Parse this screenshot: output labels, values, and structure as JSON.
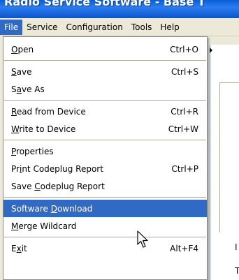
{
  "window": {
    "title": "Radio Service Software - Base T"
  },
  "menubar": {
    "items": [
      {
        "label": "File",
        "active": true
      },
      {
        "label": "Service",
        "active": false
      },
      {
        "label": "Configuration",
        "active": false
      },
      {
        "label": "Tools",
        "active": false
      },
      {
        "label": "Help",
        "active": false
      }
    ]
  },
  "file_menu": {
    "open": {
      "before": "",
      "mnemonic": "O",
      "after": "pen",
      "shortcut": "Ctrl+O"
    },
    "save": {
      "before": "",
      "mnemonic": "S",
      "after": "ave",
      "shortcut": "Ctrl+S"
    },
    "save_as": {
      "before": "S",
      "mnemonic": "a",
      "after": "ve As",
      "shortcut": ""
    },
    "read_from_device": {
      "before": "",
      "mnemonic": "R",
      "after": "ead from Device",
      "shortcut": "Ctrl+R"
    },
    "write_to_device": {
      "before": "",
      "mnemonic": "W",
      "after": "rite to Device",
      "shortcut": "Ctrl+W"
    },
    "properties": {
      "before": "",
      "mnemonic": "P",
      "after": "roperties",
      "shortcut": ""
    },
    "print_codeplug_report": {
      "before": "Pr",
      "mnemonic": "i",
      "after": "nt Codeplug Report",
      "shortcut": "Ctrl+P"
    },
    "save_codeplug_report": {
      "before": "Save ",
      "mnemonic": "C",
      "after": "odeplug Report",
      "shortcut": ""
    },
    "software_download": {
      "before": "Software ",
      "mnemonic": "D",
      "after": "ownload",
      "shortcut": "",
      "highlighted": true
    },
    "merge_wildcard": {
      "before": "",
      "mnemonic": "M",
      "after": "erge Wildcard",
      "shortcut": ""
    },
    "exit": {
      "before": "E",
      "mnemonic": "x",
      "after": "it",
      "shortcut": "Alt+F4"
    }
  },
  "background": {
    "glyph_1": "I",
    "glyph_2": "T"
  },
  "colors": {
    "highlight": "#316ac5",
    "highlight_text": "#ffffff",
    "menu_background": "#ffffff",
    "menubar_background": "#ece9d8",
    "titlebar": "#0a5fd6"
  },
  "icons": {
    "cursor": "arrow-pointer-icon"
  }
}
